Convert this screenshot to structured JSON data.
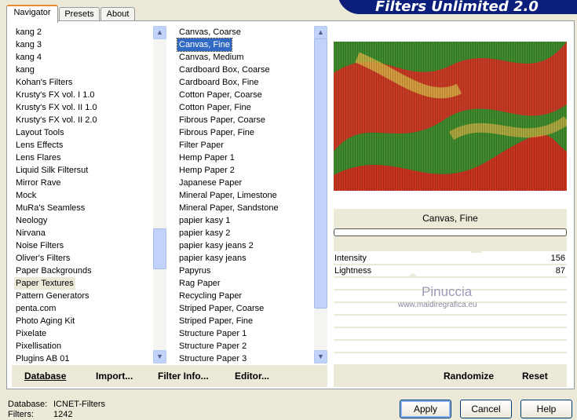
{
  "header": {
    "title": "Filters Unlimited 2.0"
  },
  "tabs": [
    {
      "label": "Navigator",
      "active": true
    },
    {
      "label": "Presets"
    },
    {
      "label": "About"
    }
  ],
  "categories": {
    "items": [
      "kang 2",
      "kang 3",
      "kang 4",
      "kang",
      "Kohan's Filters",
      "Krusty's FX vol. I 1.0",
      "Krusty's FX vol. II 1.0",
      "Krusty's FX vol. II 2.0",
      "Layout Tools",
      "Lens Effects",
      "Lens Flares",
      "Liquid Silk Filtersut",
      "Mirror Rave",
      "Mock",
      "MuRa's Seamless",
      "Neology",
      "Nirvana",
      "Noise Filters",
      "Oliver's Filters",
      "Paper Backgrounds",
      "Paper Textures",
      "Pattern Generators",
      "penta.com",
      "Photo Aging Kit",
      "Pixelate",
      "Pixellisation",
      "Plugins AB 01"
    ],
    "selected": "Paper Textures"
  },
  "filters": {
    "items": [
      "Canvas, Coarse",
      "Canvas, Fine",
      "Canvas, Medium",
      "Cardboard Box, Coarse",
      "Cardboard Box, Fine",
      "Cotton Paper, Coarse",
      "Cotton Paper, Fine",
      "Fibrous Paper, Coarse",
      "Fibrous Paper, Fine",
      "Filter Paper",
      "Hemp Paper 1",
      "Hemp Paper 2",
      "Japanese Paper",
      "Mineral Paper, Limestone",
      "Mineral Paper, Sandstone",
      "papier kasy 1",
      "papier kasy 2",
      "papier kasy jeans 2",
      "papier kasy jeans",
      "Papyrus",
      "Rag Paper",
      "Recycling Paper",
      "Striped Paper, Coarse",
      "Striped Paper, Fine",
      "Structure Paper 1",
      "Structure Paper 2",
      "Structure Paper 3"
    ],
    "selected": "Canvas, Fine"
  },
  "preview": {
    "filter_name": "Canvas, Fine",
    "watermark": "Pinuccia",
    "watermark_url": "www.maidiregrafica.eu"
  },
  "params": [
    {
      "label": "Intensity",
      "value": "156",
      "max": 255
    },
    {
      "label": "Lightness",
      "value": "87",
      "max": 255
    }
  ],
  "bottom": {
    "database": "Database",
    "import": "Import...",
    "filter_info": "Filter Info...",
    "editor": "Editor...",
    "randomize": "Randomize",
    "reset": "Reset"
  },
  "status": {
    "database_label": "Database:",
    "database_value": "ICNET-Filters",
    "filters_label": "Filters:",
    "filters_value": "1242"
  },
  "buttons": {
    "apply": "Apply",
    "cancel": "Cancel",
    "help": "Help"
  }
}
